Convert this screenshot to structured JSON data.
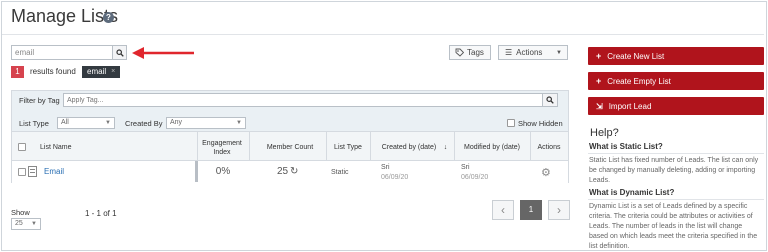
{
  "page": {
    "title": "Manage Lists"
  },
  "search": {
    "value": "email"
  },
  "results": {
    "count": "1",
    "found_label": "results found",
    "chip_label": "email",
    "chip_close": "×"
  },
  "toolbar": {
    "tags_label": "Tags",
    "actions_label": "Actions"
  },
  "filters": {
    "filter_by_tag_label": "Filter by Tag",
    "apply_tag_placeholder": "Apply Tag...",
    "list_type_label": "List Type",
    "list_type_value": "All",
    "created_by_label": "Created By",
    "created_by_value": "Any",
    "show_hidden_label": "Show Hidden"
  },
  "table": {
    "headers": {
      "list_name": "List Name",
      "engagement_index": "Engagement Index",
      "member_count": "Member Count",
      "list_type": "List Type",
      "created_by": "Created by (date)",
      "modified_by": "Modified by (date)",
      "actions": "Actions"
    },
    "rows": [
      {
        "name": "Email",
        "engagement": "0%",
        "member_count": "25",
        "list_type": "Static",
        "created_by": "Sri",
        "created_date": "06/09/20",
        "modified_by": "Sri",
        "modified_date": "06/09/20"
      }
    ]
  },
  "footer": {
    "show_label": "Show",
    "page_size": "25",
    "range_text": "1 - 1 of 1",
    "current_page": "1"
  },
  "sidebar": {
    "buttons": [
      {
        "label": "Create New List",
        "icon": "plus-icon"
      },
      {
        "label": "Create Empty List",
        "icon": "plus-icon"
      },
      {
        "label": "Import Lead",
        "icon": "import-icon"
      }
    ],
    "help_title": "Help?",
    "static_heading": "What is Static List?",
    "static_text": "Static List has fixed number of Leads. The list can only be changed by manually deleting, adding or importing Leads.",
    "dynamic_heading": "What is Dynamic List?",
    "dynamic_text": "Dynamic List is a set of Leads defined by a specific criteria. The criteria could be attributes or activities of Leads. The number of leads in the list will change based on which leads meet the criteria specified in the list definition."
  },
  "colors": {
    "accent_red": "#b0141c",
    "badge_red": "#d6434e",
    "link_blue": "#2a6fb3",
    "arrow_red": "#e0262d"
  }
}
